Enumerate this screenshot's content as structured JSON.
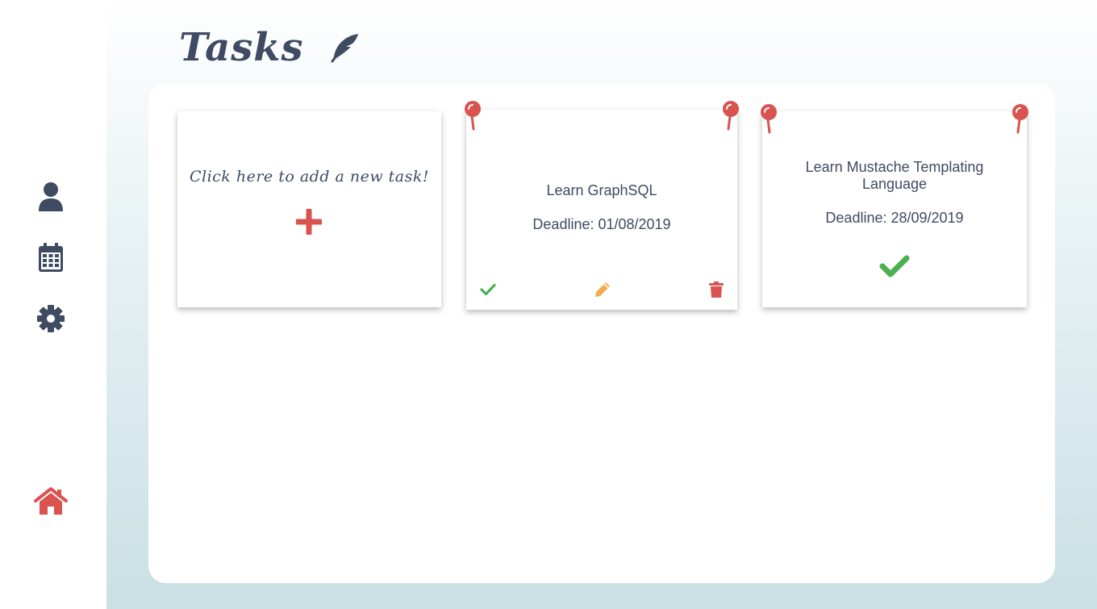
{
  "header": {
    "title": "Tasks",
    "title_icon": "feather-icon"
  },
  "sidebar": {
    "items": [
      {
        "name": "profile",
        "icon": "user-icon"
      },
      {
        "name": "calendar",
        "icon": "calendar-icon"
      },
      {
        "name": "settings",
        "icon": "gear-icon"
      },
      {
        "name": "home",
        "icon": "home-icon"
      }
    ]
  },
  "board": {
    "add_card": {
      "prompt": "Click here to add a new task!",
      "icon": "plus-icon"
    },
    "tasks": [
      {
        "title": "Learn GraphSQL",
        "deadline": "Deadline: 01/08/2019",
        "completed": false,
        "actions": [
          "check-icon",
          "pencil-icon",
          "trash-icon"
        ]
      },
      {
        "title": "Learn Mustache Templating Language",
        "deadline": "Deadline: 28/09/2019",
        "completed": true
      }
    ]
  },
  "colors": {
    "text": "#3f4a63",
    "accent_red": "#d9534f",
    "success_green": "#4caf50",
    "edit_orange": "#f0ad4e",
    "background_gradient_bottom": "#c9e0e5"
  }
}
